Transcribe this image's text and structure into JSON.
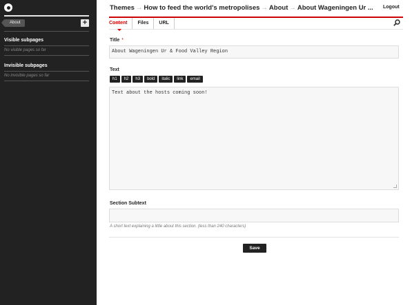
{
  "sidebar": {
    "breadcrumb_label": "About",
    "add_label": "+",
    "visible_heading": "Visible subpages",
    "visible_empty": "No visible pages so far",
    "invisible_heading": "Invisible subpages",
    "invisible_empty": "No invisible pages so far"
  },
  "header": {
    "crumbs": [
      "Themes",
      "How to feed the world's metropolises",
      "About",
      "About Wageningen Ur ..."
    ],
    "arrow": "→",
    "logout_label": "Logout"
  },
  "tabs": [
    {
      "label": "Content",
      "active": true
    },
    {
      "label": "Files",
      "active": false
    },
    {
      "label": "URL",
      "active": false
    }
  ],
  "form": {
    "title_label": "Title",
    "required_mark": "*",
    "title_value": "About Wageningen Ur & Food Valley Region",
    "text_label": "Text",
    "toolbar": [
      "h1",
      "h2",
      "h3",
      "bold",
      "italic",
      "link",
      "email"
    ],
    "text_value": "Text about the hosts coming soon!",
    "subtext_label": "Section Subtext",
    "subtext_value": "",
    "subtext_hint": "A short text explaining a little about this section. (less than 240 characters)",
    "save_label": "Save"
  },
  "colors": {
    "accent": "#cc0000",
    "sidebar_bg": "#222222"
  }
}
